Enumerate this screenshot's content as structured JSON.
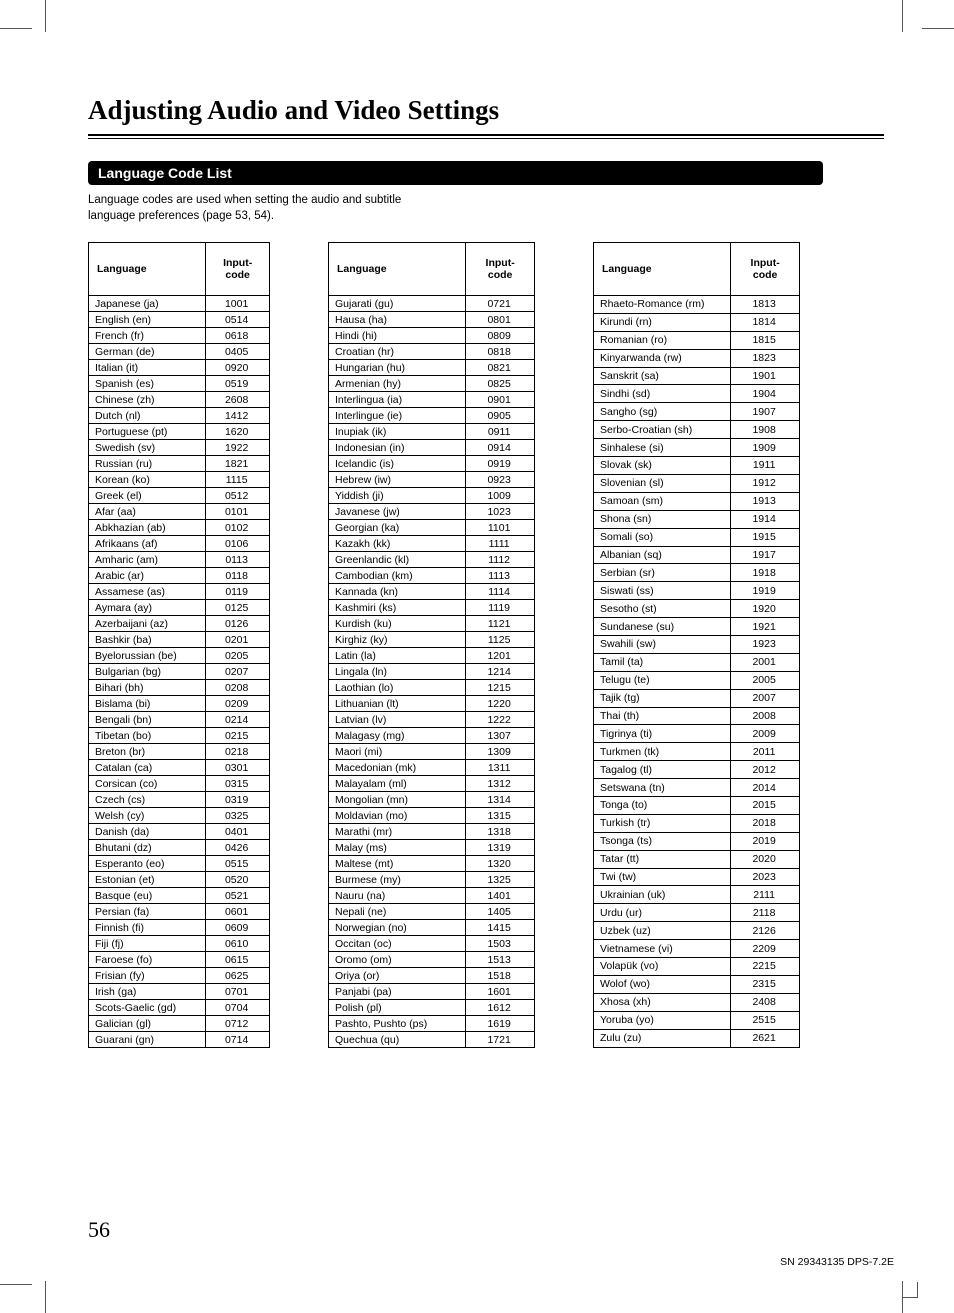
{
  "title": "Adjusting Audio and Video Settings",
  "section_heading": "Language Code List",
  "intro_line1": "Language codes are used when setting the audio and subtitle",
  "intro_line2": "language preferences (page 53, 54).",
  "headers": {
    "language": "Language",
    "code": "Input-code"
  },
  "page_number": "56",
  "footer_code": "SN 29343135 DPS-7.2E",
  "table1": [
    {
      "lang": "Japanese (ja)",
      "code": "1001"
    },
    {
      "lang": "English (en)",
      "code": "0514"
    },
    {
      "lang": "French (fr)",
      "code": "0618"
    },
    {
      "lang": "German (de)",
      "code": "0405"
    },
    {
      "lang": "Italian (it)",
      "code": "0920"
    },
    {
      "lang": "Spanish (es)",
      "code": "0519"
    },
    {
      "lang": "Chinese (zh)",
      "code": "2608"
    },
    {
      "lang": "Dutch (nl)",
      "code": "1412"
    },
    {
      "lang": "Portuguese (pt)",
      "code": "1620"
    },
    {
      "lang": "Swedish (sv)",
      "code": "1922"
    },
    {
      "lang": "Russian (ru)",
      "code": "1821"
    },
    {
      "lang": "Korean (ko)",
      "code": "1115"
    },
    {
      "lang": "Greek (el)",
      "code": "0512"
    },
    {
      "lang": "Afar (aa)",
      "code": "0101"
    },
    {
      "lang": "Abkhazian (ab)",
      "code": "0102"
    },
    {
      "lang": "Afrikaans (af)",
      "code": "0106"
    },
    {
      "lang": "Amharic (am)",
      "code": "0113"
    },
    {
      "lang": "Arabic (ar)",
      "code": "0118"
    },
    {
      "lang": "Assamese (as)",
      "code": "0119"
    },
    {
      "lang": "Aymara (ay)",
      "code": "0125"
    },
    {
      "lang": "Azerbaijani (az)",
      "code": "0126"
    },
    {
      "lang": "Bashkir (ba)",
      "code": "0201"
    },
    {
      "lang": "Byelorussian (be)",
      "code": "0205"
    },
    {
      "lang": "Bulgarian (bg)",
      "code": "0207"
    },
    {
      "lang": "Bihari (bh)",
      "code": "0208"
    },
    {
      "lang": "Bislama (bi)",
      "code": "0209"
    },
    {
      "lang": "Bengali (bn)",
      "code": "0214"
    },
    {
      "lang": "Tibetan (bo)",
      "code": "0215"
    },
    {
      "lang": "Breton (br)",
      "code": "0218"
    },
    {
      "lang": "Catalan (ca)",
      "code": "0301"
    },
    {
      "lang": "Corsican (co)",
      "code": "0315"
    },
    {
      "lang": "Czech (cs)",
      "code": "0319"
    },
    {
      "lang": "Welsh (cy)",
      "code": "0325"
    },
    {
      "lang": "Danish (da)",
      "code": "0401"
    },
    {
      "lang": "Bhutani (dz)",
      "code": "0426"
    },
    {
      "lang": "Esperanto (eo)",
      "code": "0515"
    },
    {
      "lang": "Estonian (et)",
      "code": "0520"
    },
    {
      "lang": "Basque (eu)",
      "code": "0521"
    },
    {
      "lang": "Persian (fa)",
      "code": "0601"
    },
    {
      "lang": "Finnish (fi)",
      "code": "0609"
    },
    {
      "lang": "Fiji (fj)",
      "code": "0610"
    },
    {
      "lang": "Faroese (fo)",
      "code": "0615"
    },
    {
      "lang": "Frisian (fy)",
      "code": "0625"
    },
    {
      "lang": "Irish (ga)",
      "code": "0701"
    },
    {
      "lang": "Scots-Gaelic (gd)",
      "code": "0704"
    },
    {
      "lang": "Galician (gl)",
      "code": "0712"
    },
    {
      "lang": "Guarani (gn)",
      "code": "0714"
    }
  ],
  "table2": [
    {
      "lang": "Gujarati (gu)",
      "code": "0721"
    },
    {
      "lang": "Hausa (ha)",
      "code": "0801"
    },
    {
      "lang": "Hindi (hi)",
      "code": "0809"
    },
    {
      "lang": "Croatian (hr)",
      "code": "0818"
    },
    {
      "lang": "Hungarian (hu)",
      "code": "0821"
    },
    {
      "lang": "Armenian (hy)",
      "code": "0825"
    },
    {
      "lang": "Interlingua (ia)",
      "code": "0901"
    },
    {
      "lang": "Interlingue (ie)",
      "code": "0905"
    },
    {
      "lang": "Inupiak (ik)",
      "code": "0911"
    },
    {
      "lang": "Indonesian (in)",
      "code": "0914"
    },
    {
      "lang": "Icelandic (is)",
      "code": "0919"
    },
    {
      "lang": "Hebrew (iw)",
      "code": "0923"
    },
    {
      "lang": "Yiddish (ji)",
      "code": "1009"
    },
    {
      "lang": "Javanese (jw)",
      "code": "1023"
    },
    {
      "lang": "Georgian (ka)",
      "code": "1101"
    },
    {
      "lang": "Kazakh (kk)",
      "code": "1111"
    },
    {
      "lang": "Greenlandic (kl)",
      "code": "1112"
    },
    {
      "lang": "Cambodian (km)",
      "code": "1113"
    },
    {
      "lang": "Kannada (kn)",
      "code": "1114"
    },
    {
      "lang": "Kashmiri (ks)",
      "code": "1119"
    },
    {
      "lang": "Kurdish (ku)",
      "code": "1121"
    },
    {
      "lang": "Kirghiz (ky)",
      "code": "1125"
    },
    {
      "lang": "Latin (la)",
      "code": "1201"
    },
    {
      "lang": "Lingala (ln)",
      "code": "1214"
    },
    {
      "lang": "Laothian (lo)",
      "code": "1215"
    },
    {
      "lang": "Lithuanian (lt)",
      "code": "1220"
    },
    {
      "lang": "Latvian (lv)",
      "code": "1222"
    },
    {
      "lang": "Malagasy (mg)",
      "code": "1307"
    },
    {
      "lang": "Maori (mi)",
      "code": "1309"
    },
    {
      "lang": "Macedonian (mk)",
      "code": "1311"
    },
    {
      "lang": "Malayalam (ml)",
      "code": "1312"
    },
    {
      "lang": "Mongolian (mn)",
      "code": "1314"
    },
    {
      "lang": "Moldavian (mo)",
      "code": "1315"
    },
    {
      "lang": "Marathi (mr)",
      "code": "1318"
    },
    {
      "lang": "Malay (ms)",
      "code": "1319"
    },
    {
      "lang": "Maltese (mt)",
      "code": "1320"
    },
    {
      "lang": "Burmese (my)",
      "code": "1325"
    },
    {
      "lang": "Nauru (na)",
      "code": "1401"
    },
    {
      "lang": "Nepali (ne)",
      "code": "1405"
    },
    {
      "lang": "Norwegian (no)",
      "code": "1415"
    },
    {
      "lang": "Occitan (oc)",
      "code": "1503"
    },
    {
      "lang": "Oromo (om)",
      "code": "1513"
    },
    {
      "lang": "Oriya (or)",
      "code": "1518"
    },
    {
      "lang": "Panjabi (pa)",
      "code": "1601"
    },
    {
      "lang": "Polish (pl)",
      "code": "1612"
    },
    {
      "lang": "Pashto, Pushto (ps)",
      "code": "1619"
    },
    {
      "lang": "Quechua (qu)",
      "code": "1721"
    }
  ],
  "table3": [
    {
      "lang": "Rhaeto-Romance (rm)",
      "code": "1813"
    },
    {
      "lang": "Kirundi (rn)",
      "code": "1814"
    },
    {
      "lang": "Romanian (ro)",
      "code": "1815"
    },
    {
      "lang": "Kinyarwanda (rw)",
      "code": "1823"
    },
    {
      "lang": "Sanskrit (sa)",
      "code": "1901"
    },
    {
      "lang": "Sindhi (sd)",
      "code": "1904"
    },
    {
      "lang": "Sangho (sg)",
      "code": "1907"
    },
    {
      "lang": "Serbo-Croatian (sh)",
      "code": "1908"
    },
    {
      "lang": "Sinhalese (si)",
      "code": "1909"
    },
    {
      "lang": "Slovak (sk)",
      "code": "1911"
    },
    {
      "lang": "Slovenian (sl)",
      "code": "1912"
    },
    {
      "lang": "Samoan (sm)",
      "code": "1913"
    },
    {
      "lang": "Shona (sn)",
      "code": "1914"
    },
    {
      "lang": "Somali (so)",
      "code": "1915"
    },
    {
      "lang": "Albanian (sq)",
      "code": "1917"
    },
    {
      "lang": "Serbian (sr)",
      "code": "1918"
    },
    {
      "lang": "Siswati (ss)",
      "code": "1919"
    },
    {
      "lang": "Sesotho (st)",
      "code": "1920"
    },
    {
      "lang": "Sundanese (su)",
      "code": "1921"
    },
    {
      "lang": "Swahili (sw)",
      "code": "1923"
    },
    {
      "lang": "Tamil (ta)",
      "code": "2001"
    },
    {
      "lang": "Telugu (te)",
      "code": "2005"
    },
    {
      "lang": "Tajik (tg)",
      "code": "2007"
    },
    {
      "lang": "Thai (th)",
      "code": "2008"
    },
    {
      "lang": "Tigrinya (ti)",
      "code": "2009"
    },
    {
      "lang": "Turkmen (tk)",
      "code": "2011"
    },
    {
      "lang": "Tagalog (tl)",
      "code": "2012"
    },
    {
      "lang": "Setswana (tn)",
      "code": "2014"
    },
    {
      "lang": "Tonga (to)",
      "code": "2015"
    },
    {
      "lang": "Turkish (tr)",
      "code": "2018"
    },
    {
      "lang": "Tsonga (ts)",
      "code": "2019"
    },
    {
      "lang": "Tatar (tt)",
      "code": "2020"
    },
    {
      "lang": "Twi (tw)",
      "code": "2023"
    },
    {
      "lang": "Ukrainian (uk)",
      "code": "2111"
    },
    {
      "lang": "Urdu (ur)",
      "code": "2118"
    },
    {
      "lang": "Uzbek (uz)",
      "code": "2126"
    },
    {
      "lang": "Vietnamese (vi)",
      "code": "2209"
    },
    {
      "lang": "Volapük (vo)",
      "code": "2215"
    },
    {
      "lang": "Wolof (wo)",
      "code": "2315"
    },
    {
      "lang": "Xhosa (xh)",
      "code": "2408"
    },
    {
      "lang": "Yoruba (yo)",
      "code": "2515"
    },
    {
      "lang": "Zulu (zu)",
      "code": "2621"
    }
  ]
}
